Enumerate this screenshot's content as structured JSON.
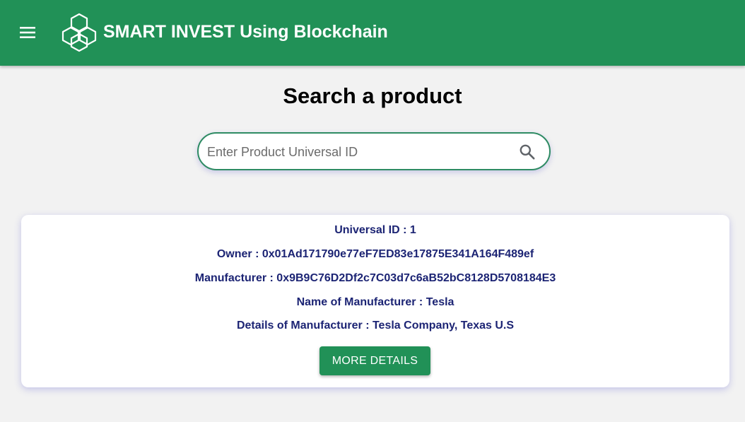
{
  "header": {
    "title": "SMART INVEST Using Blockchain",
    "menu_icon": "menu-icon",
    "logo_icon": "hexagon-logo-icon",
    "background_color": "#219157"
  },
  "main": {
    "heading": "Search a product",
    "search": {
      "placeholder": "Enter Product Universal ID",
      "value": "",
      "icon": "search-icon"
    }
  },
  "product": {
    "universal_id": "Universal ID : 1",
    "owner": "Owner : 0x01Ad171790e77eF7ED83e17875E341A164F489ef",
    "manufacturer": "Manufacturer : 0x9B9C76D2Df2c7C03d7c6aB52bC8128D5708184E3",
    "manufacturer_name": "Name of Manufacturer : Tesla",
    "manufacturer_details": "Details of Manufacturer : Tesla Company, Texas U.S",
    "more_details_label": "MORE DETAILS",
    "text_color": "#1c2474"
  }
}
